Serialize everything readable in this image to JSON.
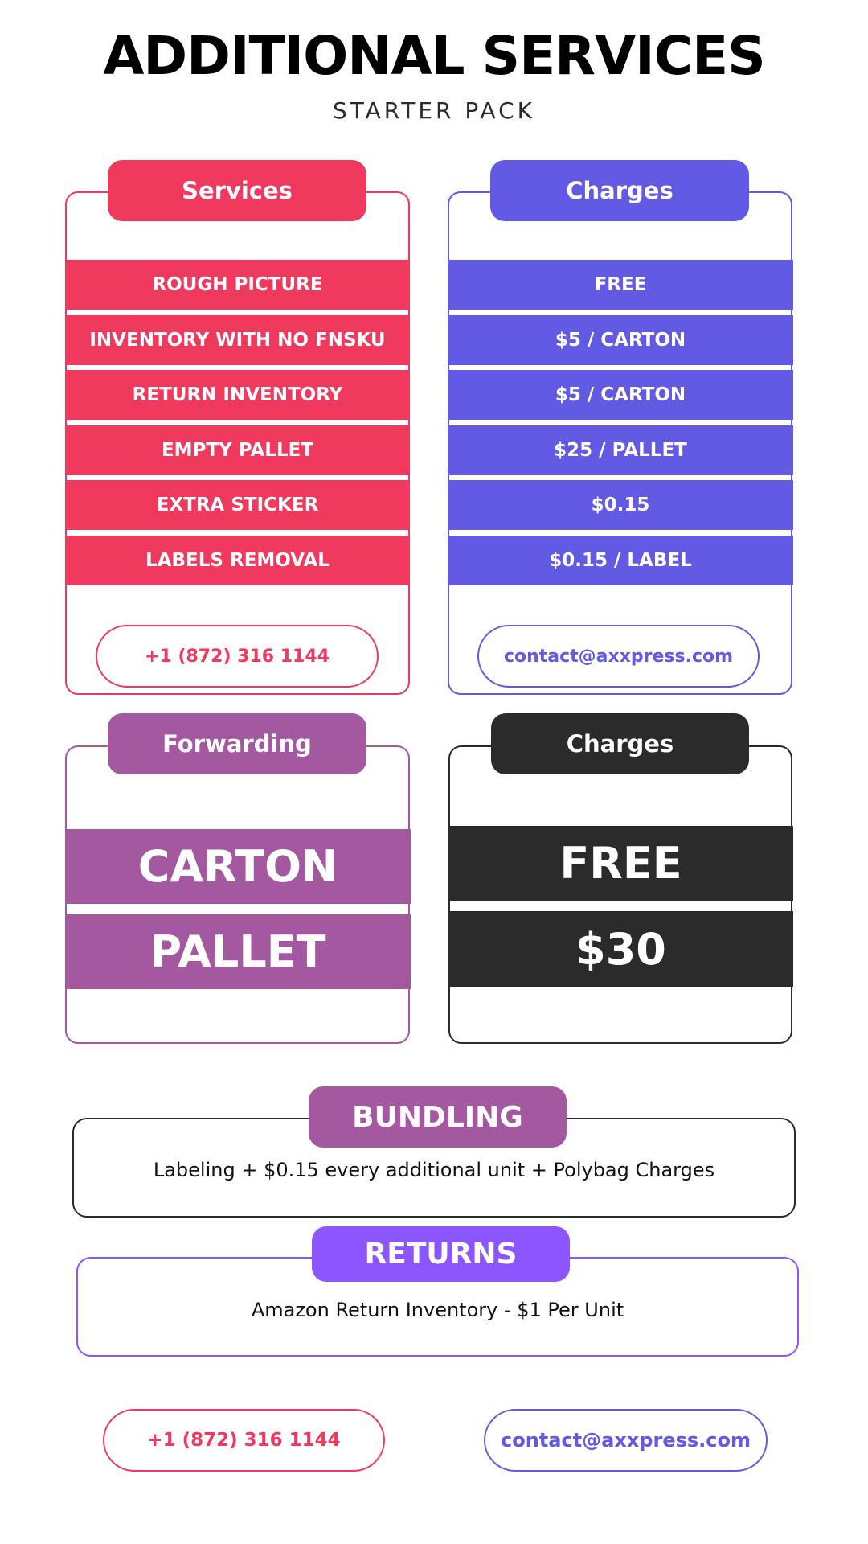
{
  "header": {
    "title": "ADDITIONAL SERVICES",
    "subtitle": "STARTER PACK"
  },
  "colors": {
    "services": "#ef3a5d",
    "charges": "#625ae2",
    "forwarding": "#a3589f",
    "dark": "#2b2b2b",
    "returns": "#8b55ff"
  },
  "services_table": {
    "header": "Services",
    "rows": [
      "ROUGH PICTURE",
      "INVENTORY WITH NO FNSKU",
      "RETURN INVENTORY",
      "EMPTY PALLET",
      "EXTRA STICKER",
      "LABELS REMOVAL"
    ],
    "contact": "+1 (872) 316 1144"
  },
  "charges_table": {
    "header": "Charges",
    "rows": [
      "FREE",
      "$5 / CARTON",
      "$5 / CARTON",
      "$25 / PALLET",
      "$0.15",
      "$0.15 / LABEL"
    ],
    "contact": "contact@axxpress.com"
  },
  "forwarding_table": {
    "header": "Forwarding",
    "rows": [
      "CARTON",
      "PALLET"
    ]
  },
  "forwarding_charges_table": {
    "header": "Charges",
    "rows": [
      "FREE",
      "$30"
    ]
  },
  "bundling": {
    "header": "BUNDLING",
    "text": "Labeling + $0.15 every additional unit  + Polybag Charges"
  },
  "returns": {
    "header": "RETURNS",
    "text": "Amazon Return Inventory - $1 Per Unit"
  },
  "footer": {
    "phone": "+1 (872) 316 1144",
    "email": "contact@axxpress.com"
  }
}
